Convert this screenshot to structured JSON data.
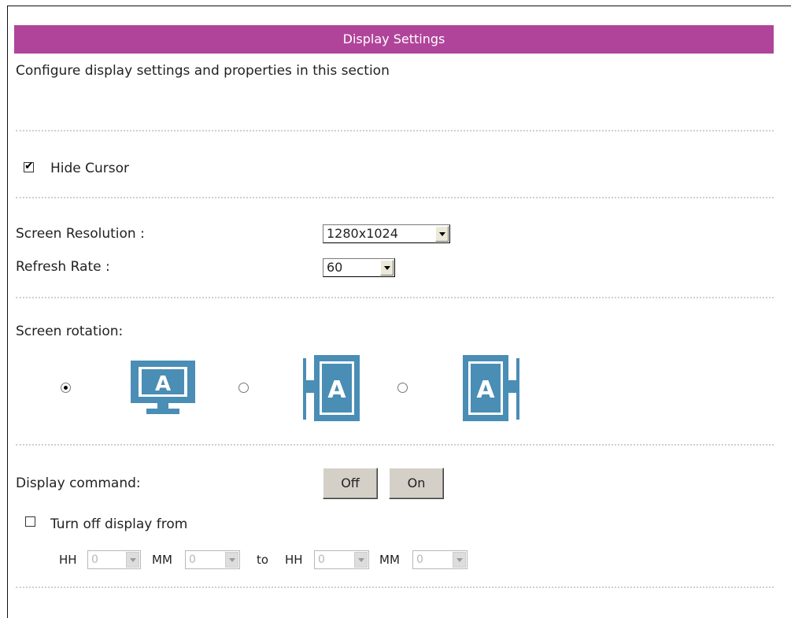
{
  "header": {
    "title": "Display Settings"
  },
  "description": "Configure display settings and properties in this section",
  "hide_cursor": {
    "label": "Hide Cursor",
    "checked": true,
    "check_glyph": "✔"
  },
  "screen_resolution": {
    "label": "Screen Resolution :",
    "value": "1280x1024"
  },
  "refresh_rate": {
    "label": "Refresh Rate :",
    "value": "60"
  },
  "rotation": {
    "label": "Screen rotation:",
    "options": [
      {
        "icon": "landscape-monitor-icon",
        "selected": true
      },
      {
        "icon": "portrait-left-icon",
        "selected": false
      },
      {
        "icon": "portrait-right-icon",
        "selected": false
      }
    ],
    "icon_letter": "A",
    "icon_color": "#4a8db5"
  },
  "display_command": {
    "label": "Display command:",
    "off_label": "Off",
    "on_label": "On"
  },
  "turn_off": {
    "label": "Turn off display from",
    "checked": false,
    "hh_label": "HH",
    "mm_label": "MM",
    "to_label": "to",
    "from_hh": "0",
    "from_mm": "0",
    "to_hh": "0",
    "to_mm": "0"
  },
  "colors": {
    "header_bg": "#b0449a",
    "divider": "#cfcfcf"
  }
}
